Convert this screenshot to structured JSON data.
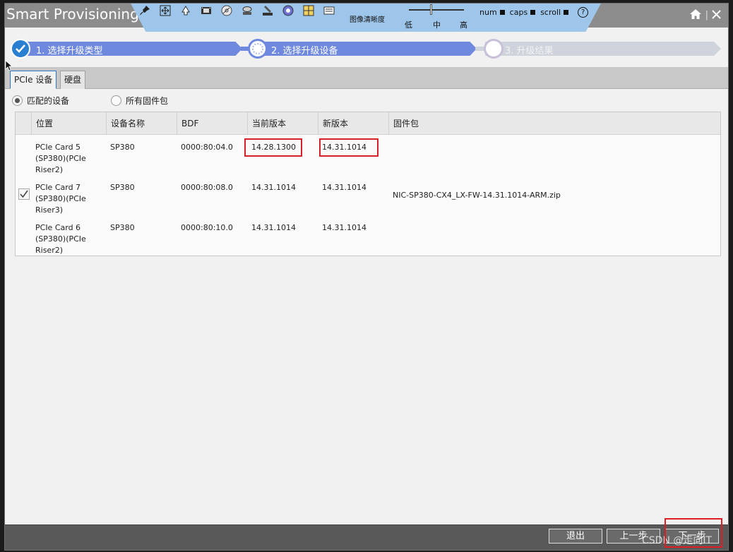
{
  "window": {
    "title": "Smart Provisioning",
    "home_icon": "home-icon",
    "close_icon": "close-icon",
    "separator": "|"
  },
  "toolbar": {
    "icons": [
      "pin-icon",
      "move-icon",
      "upload-icon",
      "film-icon",
      "cd-icon",
      "disk-icon",
      "keyboard-icon",
      "dial-icon",
      "grid-icon",
      "settings-icon"
    ],
    "quality_label": "图像清晰度",
    "slider_low": "低",
    "slider_mid": "中",
    "slider_high": "高",
    "num_label": "num",
    "caps_label": "caps",
    "scroll_label": "scroll",
    "help_label": "?"
  },
  "steps": [
    {
      "label": "1. 选择升级类型",
      "state": "done"
    },
    {
      "label": "2. 选择升级设备",
      "state": "current"
    },
    {
      "label": "3. 升级结果",
      "state": "pending"
    }
  ],
  "tabs": [
    {
      "label": "PCIe 设备",
      "active": true
    },
    {
      "label": "硬盘",
      "active": false
    }
  ],
  "filter": {
    "matched_label": "匹配的设备",
    "all_label": "所有固件包",
    "selected": "matched"
  },
  "table": {
    "headers": {
      "location": "位置",
      "device_name": "设备名称",
      "bdf": "BDF",
      "current_version": "当前版本",
      "new_version": "新版本",
      "firmware": "固件包"
    },
    "rows": [
      {
        "location": "PCIe Card 5 (SP380)(PCIe Riser2)",
        "device_name": "SP380",
        "bdf": "0000:80:04.0",
        "current_version": "14.28.1300",
        "new_version": "14.31.1014",
        "firmware": "",
        "checked": false
      },
      {
        "location": "PCIe Card 7 (SP380)(PCIe Riser3)",
        "device_name": "SP380",
        "bdf": "0000:80:08.0",
        "current_version": "14.31.1014",
        "new_version": "14.31.1014",
        "firmware": "NIC-SP380-CX4_LX-FW-14.31.1014-ARM.zip",
        "checked": true
      },
      {
        "location": "PCIe Card 6 (SP380)(PCIe Riser2)",
        "device_name": "SP380",
        "bdf": "0000:80:10.0",
        "current_version": "14.31.1014",
        "new_version": "14.31.1014",
        "firmware": "",
        "checked": false
      }
    ]
  },
  "footer": {
    "exit_label": "退出",
    "prev_label": "上一步",
    "next_label": "下一步",
    "watermark": "CSDN @走向IT"
  },
  "colors": {
    "accent": "#6f89df",
    "highlight": "#d8202a",
    "toolbar": "#9ec6ea"
  }
}
